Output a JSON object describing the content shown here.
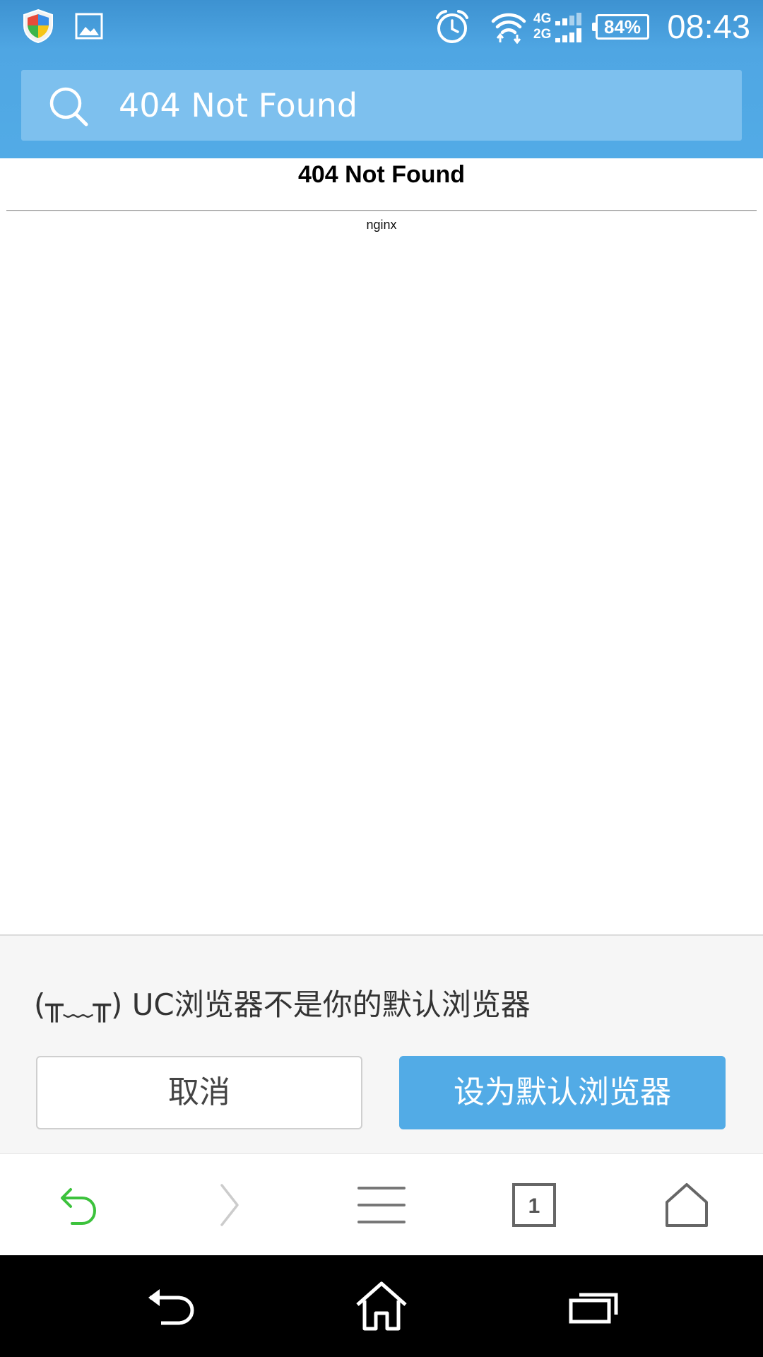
{
  "status_bar": {
    "time": "08:43",
    "battery": "84%",
    "network_top": "4G",
    "network_bottom": "2G",
    "icons": [
      "shield-icon",
      "gallery-icon",
      "alarm-icon",
      "wifi-icon",
      "signal-icon",
      "battery-icon"
    ]
  },
  "url_bar": {
    "text": "404 Not Found",
    "icon": "search-icon"
  },
  "page": {
    "title": "404 Not Found",
    "server": "nginx"
  },
  "prompt": {
    "message": "(╥﹏╥) UC浏览器不是你的默认浏览器",
    "cancel_label": "取消",
    "confirm_label": "设为默认浏览器"
  },
  "toolbar": {
    "tab_count": "1",
    "icons": [
      "back-icon",
      "forward-icon",
      "menu-icon",
      "tabs-icon",
      "home-icon"
    ],
    "back_color": "#3cc23c"
  },
  "nav_bar": {
    "icons": [
      "nav-back-icon",
      "nav-home-icon",
      "nav-recents-icon"
    ]
  },
  "colors": {
    "accent": "#52abe6",
    "statusbar": "#3d92d1",
    "urlbar_field": "#7dc0ee"
  }
}
